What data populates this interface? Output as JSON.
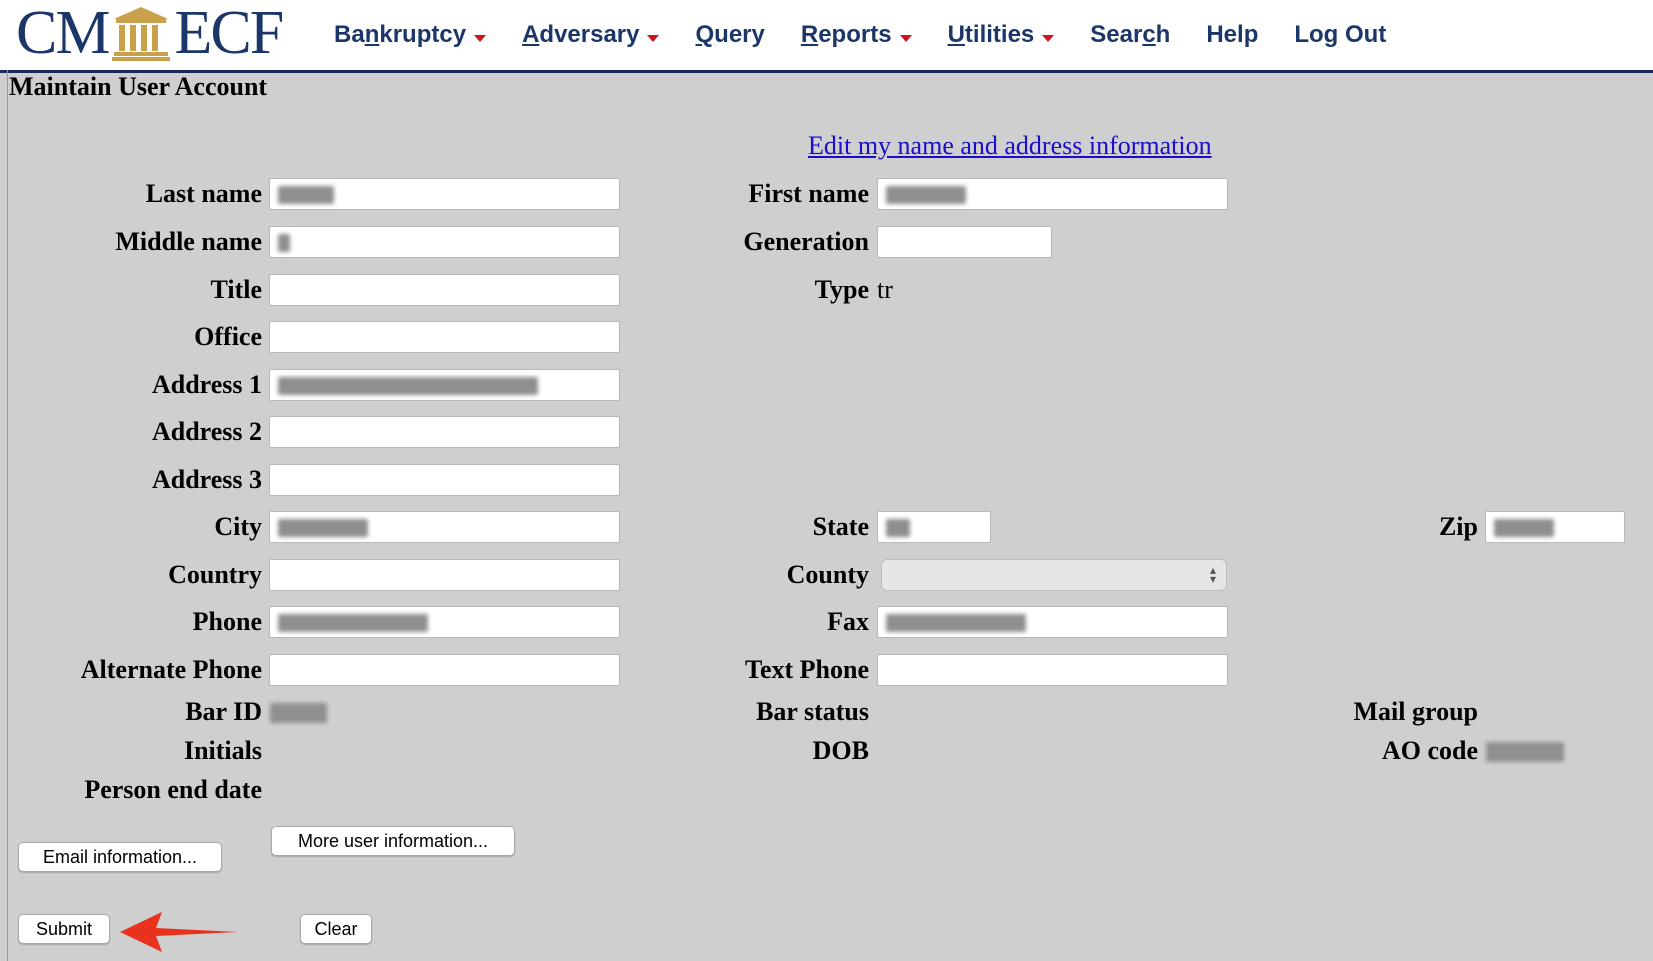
{
  "app": {
    "logo_left": "CM",
    "logo_right": "ECF",
    "brand_color": "#1b3668",
    "accent_color": "#d0121b"
  },
  "nav": {
    "bankruptcy": {
      "pre": "Ba",
      "u": "n",
      "post": "kruptcy"
    },
    "adversary": {
      "pre": "",
      "u": "A",
      "post": "dversary"
    },
    "query": {
      "pre": "",
      "u": "Q",
      "post": "uery"
    },
    "reports": {
      "pre": "",
      "u": "R",
      "post": "eports"
    },
    "utilities": {
      "pre": "",
      "u": "U",
      "post": "tilities"
    },
    "search": {
      "pre": "Sear",
      "u": "c",
      "post": "h"
    },
    "help": "Help",
    "logout": "Log Out"
  },
  "page": {
    "title": "Maintain User Account",
    "edit_link": "Edit my name and address information"
  },
  "labels": {
    "last_name": "Last name",
    "first_name": "First name",
    "middle_name": "Middle name",
    "generation": "Generation",
    "title": "Title",
    "type": "Type",
    "office": "Office",
    "address1": "Address 1",
    "address2": "Address 2",
    "address3": "Address 3",
    "city": "City",
    "state": "State",
    "zip": "Zip",
    "country": "Country",
    "county": "County",
    "phone": "Phone",
    "fax": "Fax",
    "alt_phone": "Alternate Phone",
    "text_phone": "Text Phone",
    "bar_id": "Bar ID",
    "bar_status": "Bar status",
    "mail_group": "Mail group",
    "initials": "Initials",
    "dob": "DOB",
    "ao_code": "AO code",
    "person_end_date": "Person end date"
  },
  "values": {
    "type": "tr"
  },
  "buttons": {
    "email_info": "Email information...",
    "more_user_info": "More user information...",
    "submit": "Submit",
    "clear": "Clear"
  }
}
